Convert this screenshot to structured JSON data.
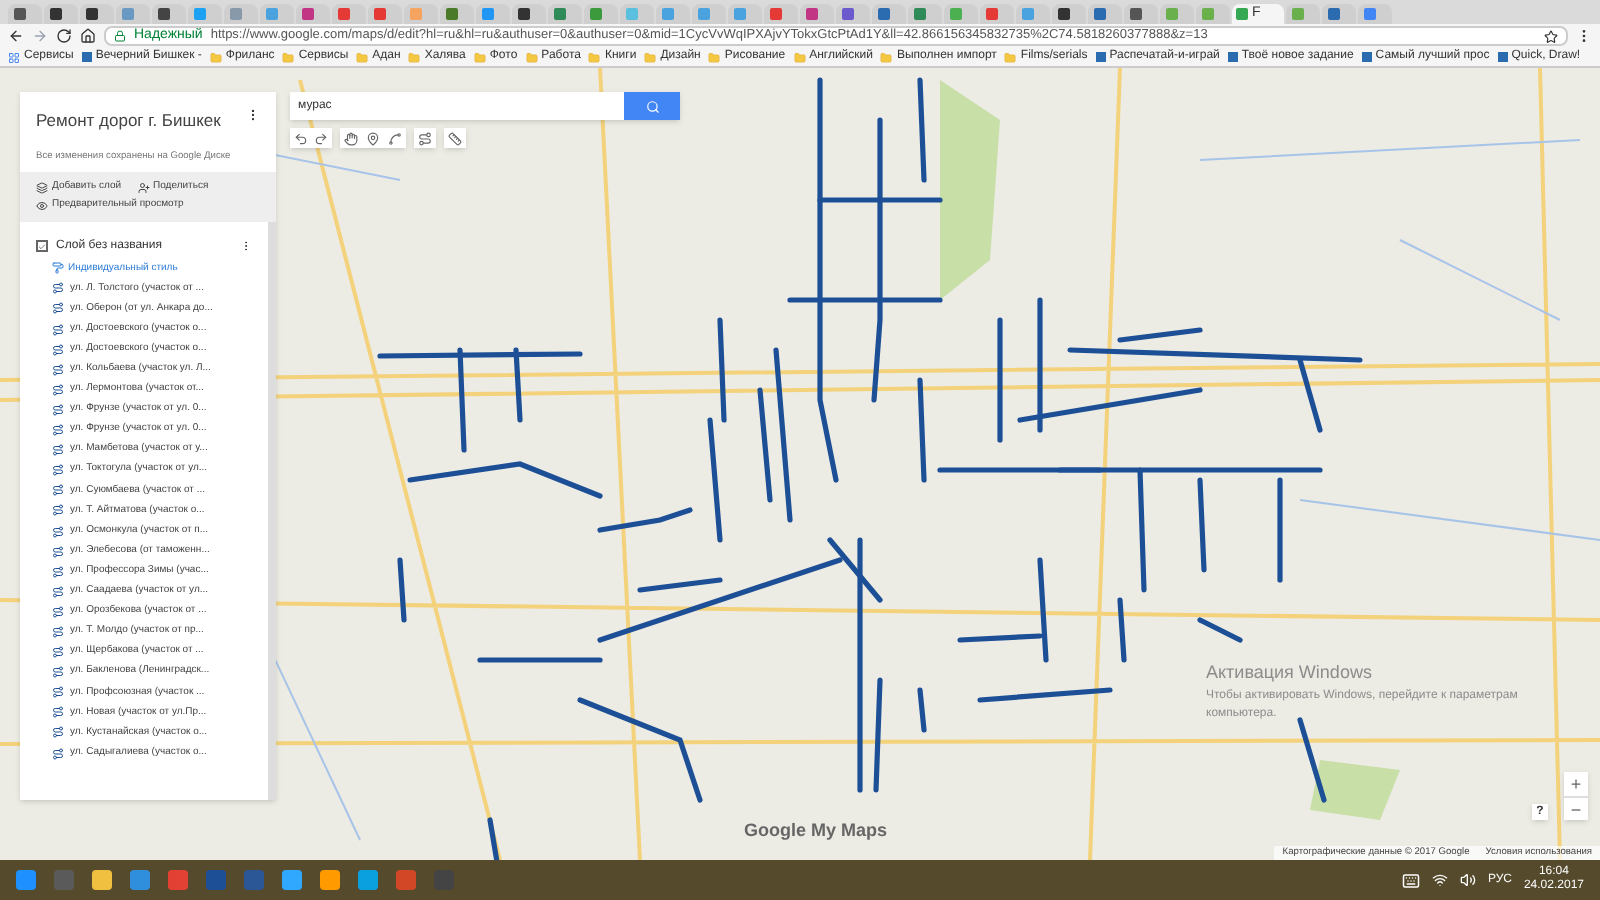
{
  "browser": {
    "tabs": [
      {
        "color": "#555555",
        "selected": false
      },
      {
        "color": "#333333",
        "selected": false
      },
      {
        "color": "#333333",
        "selected": false
      },
      {
        "color": "#6a9ac4",
        "selected": false
      },
      {
        "color": "#444444",
        "selected": false
      },
      {
        "color": "#1da1f2",
        "selected": false
      },
      {
        "color": "#8899aa",
        "selected": false
      },
      {
        "color": "#4aa3df",
        "selected": false
      },
      {
        "color": "#c13584",
        "selected": false
      },
      {
        "color": "#e53935",
        "selected": false
      },
      {
        "color": "#e53935",
        "selected": false
      },
      {
        "color": "#f4a460",
        "selected": false
      },
      {
        "color": "#4a7a2a",
        "selected": false
      },
      {
        "color": "#2196f3",
        "selected": false
      },
      {
        "color": "#333333",
        "selected": false
      },
      {
        "color": "#2e8b57",
        "selected": false
      },
      {
        "color": "#3c9a3c",
        "selected": false
      },
      {
        "color": "#5bc0de",
        "selected": false
      },
      {
        "color": "#4aa3df",
        "selected": false
      },
      {
        "color": "#4aa3df",
        "selected": false
      },
      {
        "color": "#4aa3df",
        "selected": false
      },
      {
        "color": "#e53935",
        "selected": false
      },
      {
        "color": "#c13584",
        "selected": false
      },
      {
        "color": "#6a5acd",
        "selected": false
      },
      {
        "color": "#2b6cb0",
        "selected": false
      },
      {
        "color": "#2e8b57",
        "selected": false
      },
      {
        "color": "#4caf50",
        "selected": false
      },
      {
        "color": "#e53935",
        "selected": false
      },
      {
        "color": "#4aa3df",
        "selected": false
      },
      {
        "color": "#333333",
        "selected": false
      },
      {
        "color": "#2b6cb0",
        "selected": false
      },
      {
        "color": "#555555",
        "selected": false
      },
      {
        "color": "#6ab04c",
        "selected": false
      },
      {
        "color": "#6ab04c",
        "selected": false
      },
      {
        "color": "#34a853",
        "label": "F",
        "selected": true
      },
      {
        "color": "#6ab04c",
        "selected": false
      },
      {
        "color": "#2b6cb0",
        "selected": false
      },
      {
        "color": "#4285f4",
        "selected": false
      }
    ],
    "security": "Надежный",
    "url": "https://www.google.com/maps/d/edit?hl=ru&hl=ru&authuser=0&authuser=0&mid=1CycVvWqIPXAjvYTokxGtcPtAd1Y&ll=42.866156345832735%2C74.5818260377888&z=13",
    "bookmarks": [
      {
        "kind": "apps",
        "label": "Сервисы"
      },
      {
        "kind": "site",
        "label": "Вечерний Бишкек -"
      },
      {
        "kind": "folder",
        "label": "Фриланс"
      },
      {
        "kind": "folder",
        "label": "Сервисы"
      },
      {
        "kind": "folder",
        "label": "Адан"
      },
      {
        "kind": "folder",
        "label": "Халява"
      },
      {
        "kind": "folder",
        "label": "Фото"
      },
      {
        "kind": "folder",
        "label": "Работа"
      },
      {
        "kind": "folder",
        "label": "Книги"
      },
      {
        "kind": "folder",
        "label": "Дизайн"
      },
      {
        "kind": "folder",
        "label": "Рисование"
      },
      {
        "kind": "folder",
        "label": "Английский"
      },
      {
        "kind": "folder",
        "label": "Выполнен импорт"
      },
      {
        "kind": "folder",
        "label": "Films/serials"
      },
      {
        "kind": "site",
        "label": "Распечатай-и-играй"
      },
      {
        "kind": "site",
        "label": "Твоё новое задание"
      },
      {
        "kind": "site",
        "label": "Самый лучший прос"
      },
      {
        "kind": "site",
        "label": "Quick, Draw!"
      }
    ]
  },
  "panel": {
    "title": "Ремонт дорог г. Бишкек",
    "saved": "Все изменения сохранены на Google Диске",
    "actions": [
      "Добавить слой",
      "Поделиться",
      "Предварительный просмотр"
    ],
    "layer": {
      "name": "Слой без названия",
      "checked": true,
      "style": "Индивидуальный стиль",
      "items": [
        "ул. Л. Толстого (участок от ...",
        "ул. Оберон (от ул. Анкара до...",
        "ул. Достоевского (участок о...",
        "ул. Достоевского (участок о...",
        "ул. Кольбаева (участок ул. Л...",
        "ул. Лермонтова (участок от...",
        "ул. Фрунзе (участок от ул. 0...",
        "ул. Фрунзе (участок от ул. 0...",
        "ул. Мамбетова (участок от у...",
        "ул. Токтогула (участок от ул...",
        "ул. Суюмбаева (участок от ...",
        "ул. Т. Айтматова (участок о...",
        "ул. Осмонкула (участок от п...",
        "ул. Элебесова (от таможенн...",
        "ул. Профессора Зимы (учас...",
        "ул. Саадаева (участок от ул...",
        "ул. Орозбекова (участок от ...",
        "ул. Т. Молдо (участок от пр...",
        "ул. Щербакова (участок от ...",
        "ул. Бакленова (Ленинградск...",
        "ул. Профсоюзная (участок ...",
        "ул. Новая (участок от ул.Пр...",
        "ул. Кустанайская (участок о...",
        "ул. Садыгалиева (участок о..."
      ]
    }
  },
  "search": {
    "value": "мурас"
  },
  "map": {
    "brand": "Google My Maps",
    "attribution": "Картографические данные © 2017 Google",
    "terms": "Условия использования",
    "zoom_in": "+",
    "zoom_out": "−",
    "help": "?"
  },
  "activation": {
    "title": "Активация Windows",
    "text": "Чтобы активировать Windows, перейдите к параметрам компьютера."
  },
  "taskbar": {
    "language": "РУС",
    "time": "16:04",
    "date": "24.02.2017"
  }
}
